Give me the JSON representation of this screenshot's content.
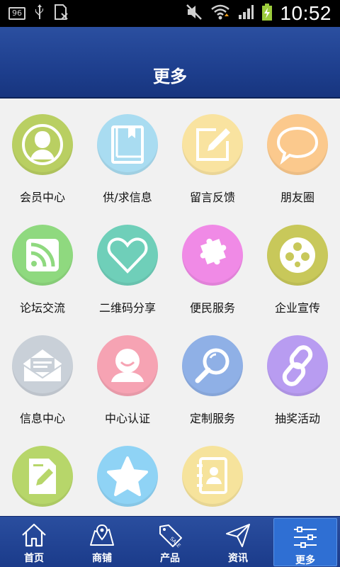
{
  "status_bar": {
    "notification_badge": "96",
    "time": "10:52"
  },
  "header": {
    "title": "更多"
  },
  "grid": {
    "items": [
      {
        "label": "会员中心",
        "icon": "member-icon",
        "color": "#b9cf62"
      },
      {
        "label": "供/求信息",
        "icon": "book-icon",
        "color": "#a9dcf1"
      },
      {
        "label": "留言反馈",
        "icon": "message-edit-icon",
        "color": "#f9e3a0"
      },
      {
        "label": "朋友圈",
        "icon": "chat-bubble-icon",
        "color": "#fbc98d"
      },
      {
        "label": "论坛交流",
        "icon": "rss-icon",
        "color": "#8fd97f"
      },
      {
        "label": "二维码分享",
        "icon": "heart-icon",
        "color": "#6fcfb9"
      },
      {
        "label": "便民服务",
        "icon": "puzzle-icon",
        "color": "#f08ae6"
      },
      {
        "label": "企业宣传",
        "icon": "film-reel-icon",
        "color": "#c8c85a"
      },
      {
        "label": "信息中心",
        "icon": "mail-icon",
        "color": "#c9d0d8"
      },
      {
        "label": "中心认证",
        "icon": "user-smile-icon",
        "color": "#f6a3b3"
      },
      {
        "label": "定制服务",
        "icon": "search-icon",
        "color": "#8fb0e6"
      },
      {
        "label": "抽奖活动",
        "icon": "link-icon",
        "color": "#b89cf1"
      },
      {
        "label": "",
        "icon": "edit-doc-icon",
        "color": "#b7d66a"
      },
      {
        "label": "",
        "icon": "star-icon",
        "color": "#8fd3f5"
      },
      {
        "label": "",
        "icon": "contacts-icon",
        "color": "#f6e39c"
      }
    ]
  },
  "bottom_nav": {
    "tabs": [
      {
        "label": "首页",
        "icon": "home-icon"
      },
      {
        "label": "商铺",
        "icon": "store-icon"
      },
      {
        "label": "产品",
        "icon": "sale-tag-icon"
      },
      {
        "label": "资讯",
        "icon": "paper-plane-icon"
      },
      {
        "label": "更多",
        "icon": "settings-sliders-icon",
        "active": true
      }
    ]
  }
}
